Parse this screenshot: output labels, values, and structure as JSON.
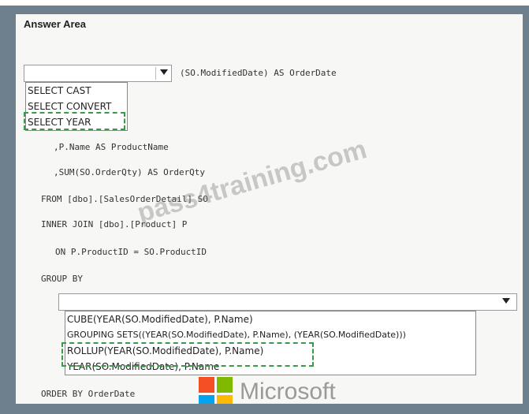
{
  "panel_title": "Answer Area",
  "select_dropdown": {
    "options": [
      "SELECT CAST",
      "SELECT CONVERT",
      "SELECT YEAR"
    ]
  },
  "code": {
    "select_suffix": "(SO.ModifiedDate) AS OrderDate",
    "line_name": ",P.Name AS ProductName",
    "line_sum": ",SUM(SO.OrderQty) AS OrderQty",
    "line_from": "FROM [dbo].[SalesOrderDetail] SO",
    "line_join": "INNER JOIN [dbo].[Product] P",
    "line_on": "ON P.ProductID = SO.ProductID",
    "line_group": "GROUP BY",
    "line_order": "ORDER BY OrderDate"
  },
  "groupby_dropdown": {
    "options": [
      "CUBE(YEAR(SO.ModifiedDate), P.Name)",
      "GROUPING SETS((YEAR(SO.ModifiedDate), P.Name), (YEAR(SO.ModifiedDate)))",
      "ROLLUP(YEAR(SO.ModifiedDate), P.Name)",
      "YEAR(SO.ModifiedDate), P.Name"
    ]
  },
  "watermark": "pass4training.com",
  "logo": {
    "text": "Microsoft",
    "colors": [
      "#f25022",
      "#7fba00",
      "#00a4ef",
      "#ffb900"
    ]
  },
  "selection_color": "#3a9a4a"
}
